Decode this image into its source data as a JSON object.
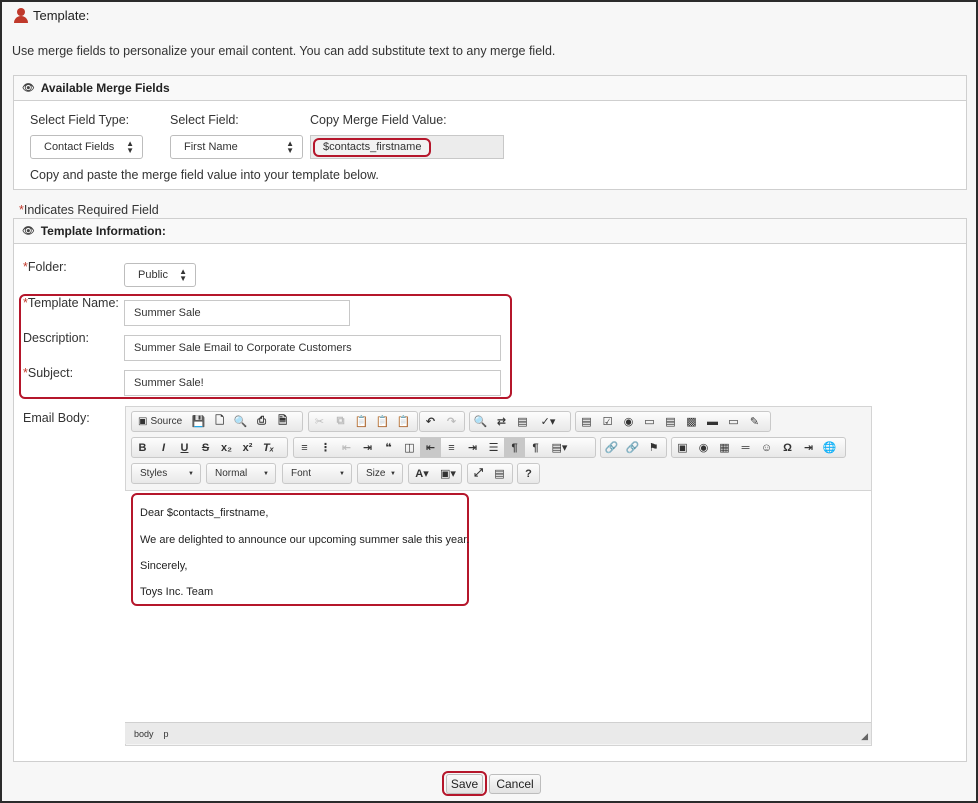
{
  "header": {
    "title": "Template:"
  },
  "intro": "Use merge fields to personalize your email content. You can add substitute text to any merge field.",
  "merge_panel": {
    "title": "Available Merge Fields",
    "field_type_label": "Select Field Type:",
    "field_label": "Select Field:",
    "copy_label": "Copy Merge Field Value:",
    "field_type_value": "Contact Fields",
    "field_value": "First Name",
    "merge_value": "$contacts_firstname",
    "hint": "Copy and paste the merge field value into your template below."
  },
  "required_note": {
    "mark": "*",
    "text": "Indicates Required Field"
  },
  "template_panel": {
    "title": "Template Information:",
    "folder_label": "Folder:",
    "folder_value": "Public",
    "name_label": "Template Name:",
    "name_value": "Summer Sale",
    "description_label": "Description:",
    "description_value": "Summer Sale Email to Corporate Customers",
    "subject_label": "Subject:",
    "subject_value": "Summer Sale!",
    "body_label": "Email Body:",
    "required_mark": "*"
  },
  "editor": {
    "source_label": "Source",
    "styles_label": "Styles",
    "format_label": "Normal",
    "font_label": "Font",
    "size_label": "Size",
    "body_lines": [
      "Dear $contacts_firstname,",
      "We are delighted to announce our upcoming summer sale this year.",
      "Sincerely,",
      "Toys Inc. Team"
    ],
    "path": [
      "body",
      "p"
    ]
  },
  "actions": {
    "save": "Save",
    "cancel": "Cancel"
  },
  "colors": {
    "required": "#c0392b",
    "highlight": "#b5162b"
  }
}
